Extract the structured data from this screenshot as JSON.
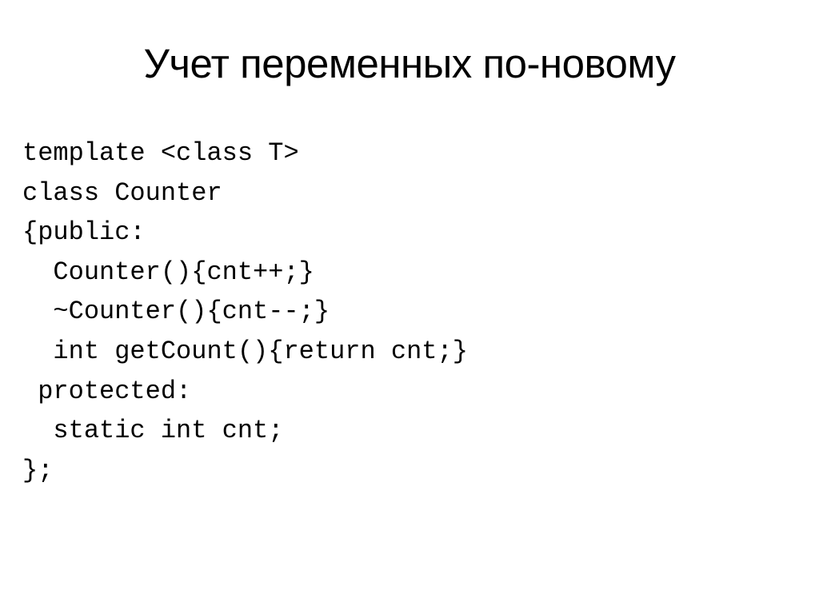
{
  "slide": {
    "title": "Учет переменных по-новому",
    "code": {
      "line1": "template <class T>",
      "line2": "class Counter",
      "line3": "{public:",
      "line4": "  Counter(){cnt++;}",
      "line5": "  ~Counter(){cnt--;}",
      "line6": "  int getCount(){return cnt;}",
      "line7": " protected:",
      "line8": "  static int cnt;",
      "line9": "};"
    }
  }
}
